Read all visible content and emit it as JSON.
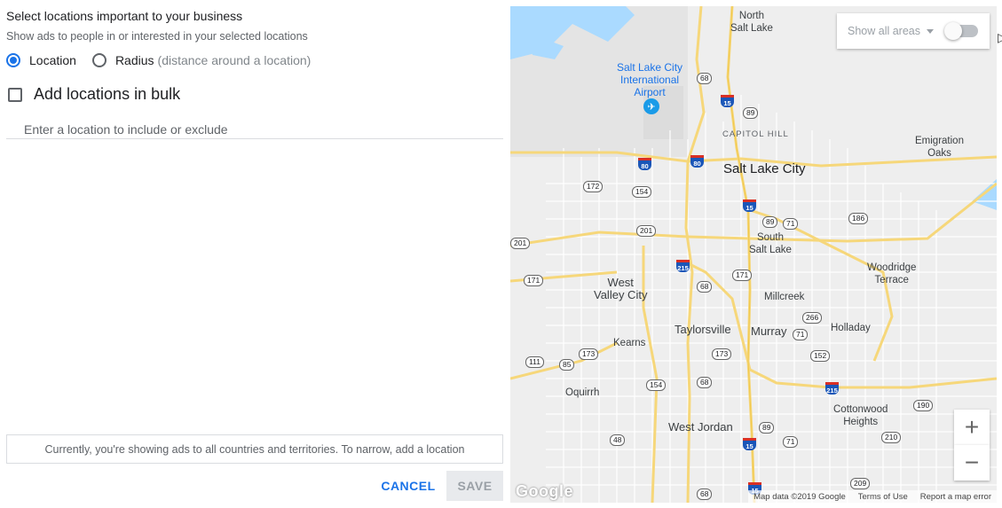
{
  "panel": {
    "title": "Select locations important to your business",
    "subtitle": "Show ads to people in or interested in your selected locations",
    "radio_location": "Location",
    "radio_radius": "Radius",
    "radio_radius_hint": "(distance around a location)",
    "bulk_label": "Add locations in bulk",
    "location_input": {
      "value": "",
      "placeholder": "Enter a location to include or exclude"
    },
    "notice": "Currently, you're showing ads to all countries and territories. To narrow, add a location",
    "cancel_label": "CANCEL",
    "save_label": "SAVE",
    "selected_radio": "location"
  },
  "map": {
    "show_areas_label": "Show all areas",
    "show_areas_enabled": false,
    "zoom_in": "+",
    "zoom_out": "−",
    "logo": "Google",
    "footer": {
      "data": "Map data ©2019 Google",
      "terms": "Terms of Use",
      "report": "Report a map error"
    },
    "labels": {
      "north_salt_lake_1": "North",
      "north_salt_lake_2": "Salt Lake",
      "airport_1": "Salt Lake City",
      "airport_2": "International",
      "airport_3": "Airport",
      "capitol_hill": "CAPITOL HILL",
      "slc": "Salt Lake City",
      "emigration_1": "Emigration",
      "emigration_2": "Oaks",
      "south_salt_lake_1": "South",
      "south_salt_lake_2": "Salt Lake",
      "woodridge_1": "Woodridge",
      "woodridge_2": "Terrace",
      "west_valley_1": "West",
      "west_valley_2": "Valley City",
      "millcreek": "Millcreek",
      "taylorsville": "Taylorsville",
      "murray": "Murray",
      "holladay": "Holladay",
      "kearns": "Kearns",
      "oquirrh": "Oquirrh",
      "cottonwood_1": "Cottonwood",
      "cottonwood_2": "Heights",
      "west_jordan": "West Jordan"
    },
    "shields": {
      "r68a": "68",
      "r89a": "89",
      "r172": "172",
      "r154a": "154",
      "r89b": "89",
      "r71a": "71",
      "r186": "186",
      "r201a": "201",
      "r201b": "201",
      "r171a": "171",
      "r68b": "68",
      "r171b": "171",
      "r266": "266",
      "r71b": "71",
      "r173a": "173",
      "r173b": "173",
      "r152": "152",
      "r111": "111",
      "r85": "85",
      "r154b": "154",
      "r68c": "68",
      "r190": "190",
      "r89c": "89",
      "r48": "48",
      "r71c": "71",
      "r210": "210",
      "r209": "209",
      "r68d": "68"
    },
    "interstates": {
      "i15a": "15",
      "i80a": "80",
      "i80b": "80",
      "i15b": "15",
      "i215a": "215",
      "i215b": "215",
      "i15c": "15",
      "i15d": "15"
    }
  }
}
